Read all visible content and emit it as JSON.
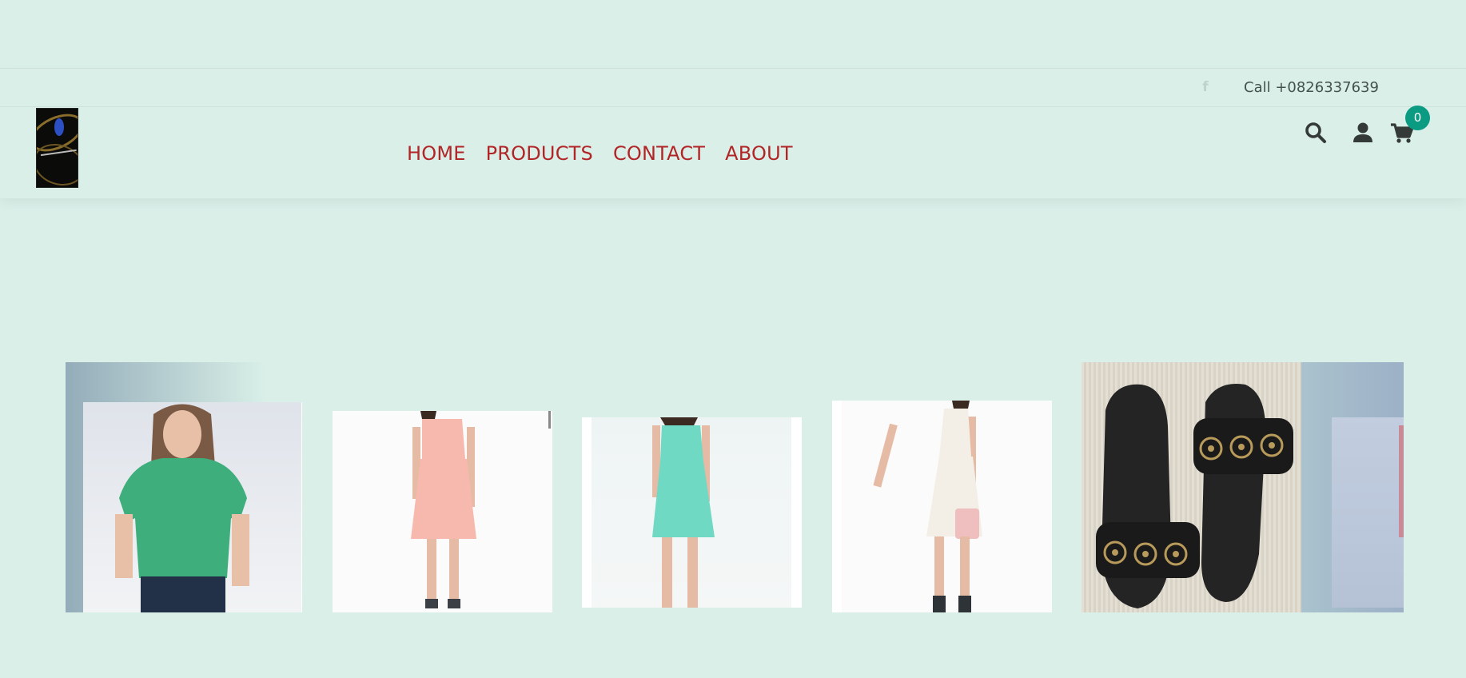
{
  "header": {
    "facebook_icon": "facebook-icon",
    "call_text": "Call +0826337639",
    "logo": "brand-logo",
    "nav": [
      {
        "label": "HOME"
      },
      {
        "label": "PRODUCTS"
      },
      {
        "label": "CONTACT"
      },
      {
        "label": "ABOUT"
      }
    ],
    "icons": [
      "search-icon",
      "user-icon",
      "cart-icon"
    ],
    "cart_count": "0",
    "nav_color": "#b22527",
    "badge_color": "#0b9b83"
  },
  "gallery": {
    "items": [
      {
        "name": "green-shirt",
        "color": "#3fae7d"
      },
      {
        "name": "peach-dress",
        "color": "#f7b9ad"
      },
      {
        "name": "mint-dress",
        "color": "#6fd9c3"
      },
      {
        "name": "white-dress",
        "color": "#f3eee6"
      },
      {
        "name": "black-sandals",
        "color": "#222222"
      },
      {
        "name": "partial-item",
        "color": "#c2cddf"
      }
    ]
  },
  "colors": {
    "background": "#d9efe8",
    "text": "#44524e"
  }
}
